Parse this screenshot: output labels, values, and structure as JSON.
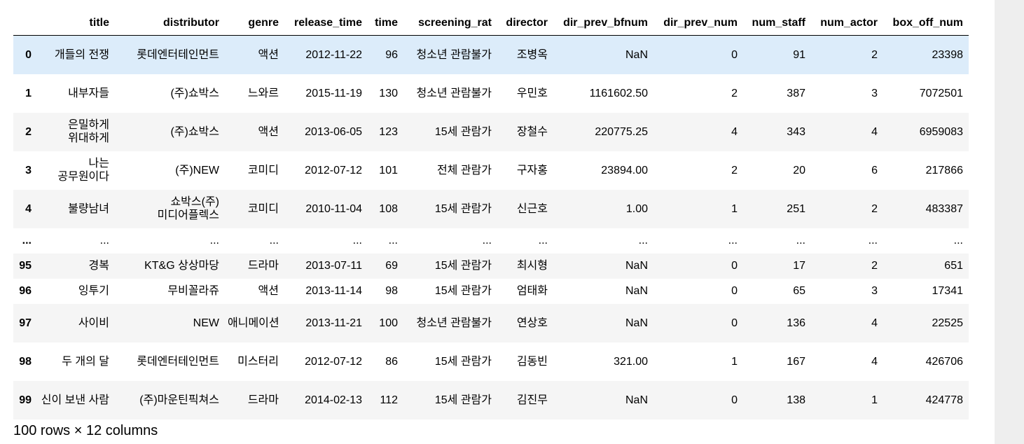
{
  "table": {
    "columns": [
      "",
      "title",
      "distributor",
      "genre",
      "release_time",
      "time",
      "screening_rat",
      "director",
      "dir_prev_bfnum",
      "dir_prev_num",
      "num_staff",
      "num_actor",
      "box_off_num"
    ],
    "rows": [
      [
        "0",
        "개들의 전쟁",
        "롯데엔터테인먼트",
        "액션",
        "2012-11-22",
        "96",
        "청소년 관람불가",
        "조병옥",
        "NaN",
        "0",
        "91",
        "2",
        "23398"
      ],
      [
        "1",
        "내부자들",
        "(주)쇼박스",
        "느와르",
        "2015-11-19",
        "130",
        "청소년 관람불가",
        "우민호",
        "1161602.50",
        "2",
        "387",
        "3",
        "7072501"
      ],
      [
        "2",
        "은밀하게 위대하게",
        "(주)쇼박스",
        "액션",
        "2013-06-05",
        "123",
        "15세 관람가",
        "장철수",
        "220775.25",
        "4",
        "343",
        "4",
        "6959083"
      ],
      [
        "3",
        "나는 공무원이다",
        "(주)NEW",
        "코미디",
        "2012-07-12",
        "101",
        "전체 관람가",
        "구자홍",
        "23894.00",
        "2",
        "20",
        "6",
        "217866"
      ],
      [
        "4",
        "불량남녀",
        "쇼박스(주)미디어플렉스",
        "코미디",
        "2010-11-04",
        "108",
        "15세 관람가",
        "신근호",
        "1.00",
        "1",
        "251",
        "2",
        "483387"
      ],
      [
        "...",
        "...",
        "...",
        "...",
        "...",
        "...",
        "...",
        "...",
        "...",
        "...",
        "...",
        "...",
        "..."
      ],
      [
        "95",
        "경복",
        "KT&G 상상마당",
        "드라마",
        "2013-07-11",
        "69",
        "15세 관람가",
        "최시형",
        "NaN",
        "0",
        "17",
        "2",
        "651"
      ],
      [
        "96",
        "잉투기",
        "무비꼴라쥬",
        "액션",
        "2013-11-14",
        "98",
        "15세 관람가",
        "엄태화",
        "NaN",
        "0",
        "65",
        "3",
        "17341"
      ],
      [
        "97",
        "사이비",
        "NEW",
        "애니메이션",
        "2013-11-21",
        "100",
        "청소년 관람불가",
        "연상호",
        "NaN",
        "0",
        "136",
        "4",
        "22525"
      ],
      [
        "98",
        "두 개의 달",
        "롯데엔터테인먼트",
        "미스터리",
        "2012-07-12",
        "86",
        "15세 관람가",
        "김동빈",
        "321.00",
        "1",
        "167",
        "4",
        "426706"
      ],
      [
        "99",
        "신이 보낸 사람",
        "(주)마운틴픽쳐스",
        "드라마",
        "2014-02-13",
        "112",
        "15세 관람가",
        "김진무",
        "NaN",
        "0",
        "138",
        "1",
        "424778"
      ]
    ]
  },
  "shape_text": "100 rows × 12 columns",
  "colors": {
    "hover_row": "#dcecfa",
    "striped_row": "#f5f5f5",
    "scrollbar_track": "#eeeeee"
  }
}
